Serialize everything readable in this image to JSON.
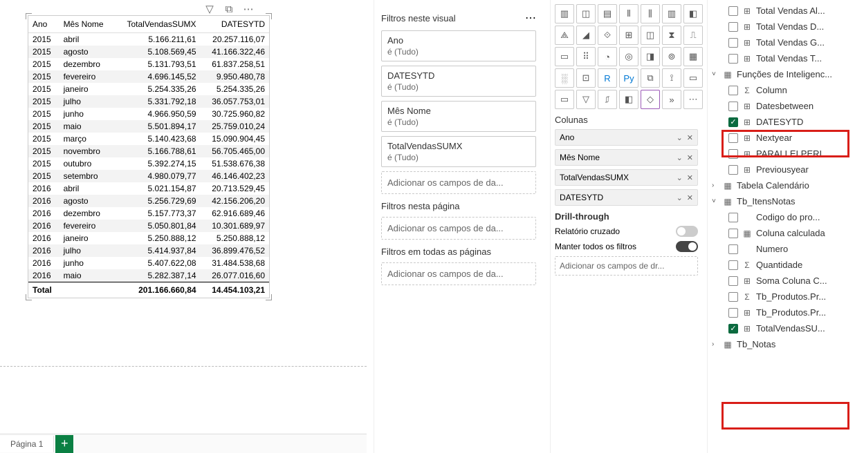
{
  "table_visual": {
    "headers": [
      "Ano",
      "Mês Nome",
      "TotalVendasSUMX",
      "DATESYTD"
    ],
    "rows": [
      [
        "2015",
        "abril",
        "5.166.211,61",
        "20.257.116,07"
      ],
      [
        "2015",
        "agosto",
        "5.108.569,45",
        "41.166.322,46"
      ],
      [
        "2015",
        "dezembro",
        "5.131.793,51",
        "61.837.258,51"
      ],
      [
        "2015",
        "fevereiro",
        "4.696.145,52",
        "9.950.480,78"
      ],
      [
        "2015",
        "janeiro",
        "5.254.335,26",
        "5.254.335,26"
      ],
      [
        "2015",
        "julho",
        "5.331.792,18",
        "36.057.753,01"
      ],
      [
        "2015",
        "junho",
        "4.966.950,59",
        "30.725.960,82"
      ],
      [
        "2015",
        "maio",
        "5.501.894,17",
        "25.759.010,24"
      ],
      [
        "2015",
        "março",
        "5.140.423,68",
        "15.090.904,45"
      ],
      [
        "2015",
        "novembro",
        "5.166.788,61",
        "56.705.465,00"
      ],
      [
        "2015",
        "outubro",
        "5.392.274,15",
        "51.538.676,38"
      ],
      [
        "2015",
        "setembro",
        "4.980.079,77",
        "46.146.402,23"
      ],
      [
        "2016",
        "abril",
        "5.021.154,87",
        "20.713.529,45"
      ],
      [
        "2016",
        "agosto",
        "5.256.729,69",
        "42.156.206,20"
      ],
      [
        "2016",
        "dezembro",
        "5.157.773,37",
        "62.916.689,46"
      ],
      [
        "2016",
        "fevereiro",
        "5.050.801,84",
        "10.301.689,97"
      ],
      [
        "2016",
        "janeiro",
        "5.250.888,12",
        "5.250.888,12"
      ],
      [
        "2016",
        "julho",
        "5.414.937,84",
        "36.899.476,52"
      ],
      [
        "2016",
        "junho",
        "5.407.622,08",
        "31.484.538,68"
      ],
      [
        "2016",
        "maio",
        "5.282.387,14",
        "26.077.016,60"
      ]
    ],
    "total_row": [
      "Total",
      "",
      "201.166.660,84",
      "14.454.103,21"
    ]
  },
  "page_tab": {
    "label": "Página 1",
    "add": "+"
  },
  "filters": {
    "visual": {
      "title": "Filtros neste visual",
      "tudo": "é (Tudo)",
      "cards": [
        "Ano",
        "DATESYTD",
        "Mês Nome",
        "TotalVendasSUMX"
      ],
      "add": "Adicionar os campos de da..."
    },
    "page": {
      "title": "Filtros nesta página",
      "add": "Adicionar os campos de da..."
    },
    "all": {
      "title": "Filtros em todas as páginas",
      "add": "Adicionar os campos de da..."
    }
  },
  "viz": {
    "columns_title": "Colunas",
    "fields": [
      "Ano",
      "Mês Nome",
      "TotalVendasSUMX",
      "DATESYTD"
    ],
    "drill_title": "Drill-through",
    "cross": "Relatório cruzado",
    "keep": "Manter todos os filtros",
    "add": "Adicionar os campos de dr..."
  },
  "fields_panel": {
    "top": [
      {
        "label": "Total Vendas Al...",
        "icon": "calc"
      },
      {
        "label": "Total Vendas D...",
        "icon": "calc"
      },
      {
        "label": "Total Vendas G...",
        "icon": "calc"
      },
      {
        "label": "Total Vendas T...",
        "icon": "calc"
      }
    ],
    "g_func_title": "Funções de Inteligenc...",
    "g_func": [
      {
        "label": "Column",
        "icon": "sum",
        "checked": false
      },
      {
        "label": "Datesbetween",
        "icon": "calc",
        "checked": false
      },
      {
        "label": "DATESYTD",
        "icon": "calc",
        "checked": true
      },
      {
        "label": "Nextyear",
        "icon": "calc",
        "checked": false
      },
      {
        "label": "PARALLELPERI...",
        "icon": "calc",
        "checked": false
      },
      {
        "label": "Previousyear",
        "icon": "calc",
        "checked": false
      }
    ],
    "g_cal_title": "Tabela Calendário",
    "g_itens_title": "Tb_ItensNotas",
    "g_itens": [
      {
        "label": "Codigo do pro...",
        "icon": "none",
        "checked": false
      },
      {
        "label": "Coluna calculada",
        "icon": "colcalc",
        "checked": false
      },
      {
        "label": "Numero",
        "icon": "none",
        "checked": false
      },
      {
        "label": "Quantidade",
        "icon": "sum",
        "checked": false
      },
      {
        "label": "Soma Coluna C...",
        "icon": "calc",
        "checked": false
      },
      {
        "label": "Tb_Produtos.Pr...",
        "icon": "sum",
        "checked": false
      },
      {
        "label": "Tb_Produtos.Pr...",
        "icon": "calc",
        "checked": false
      },
      {
        "label": "TotalVendasSU...",
        "icon": "calc",
        "checked": true
      }
    ],
    "g_notas_title": "Tb_Notas"
  }
}
